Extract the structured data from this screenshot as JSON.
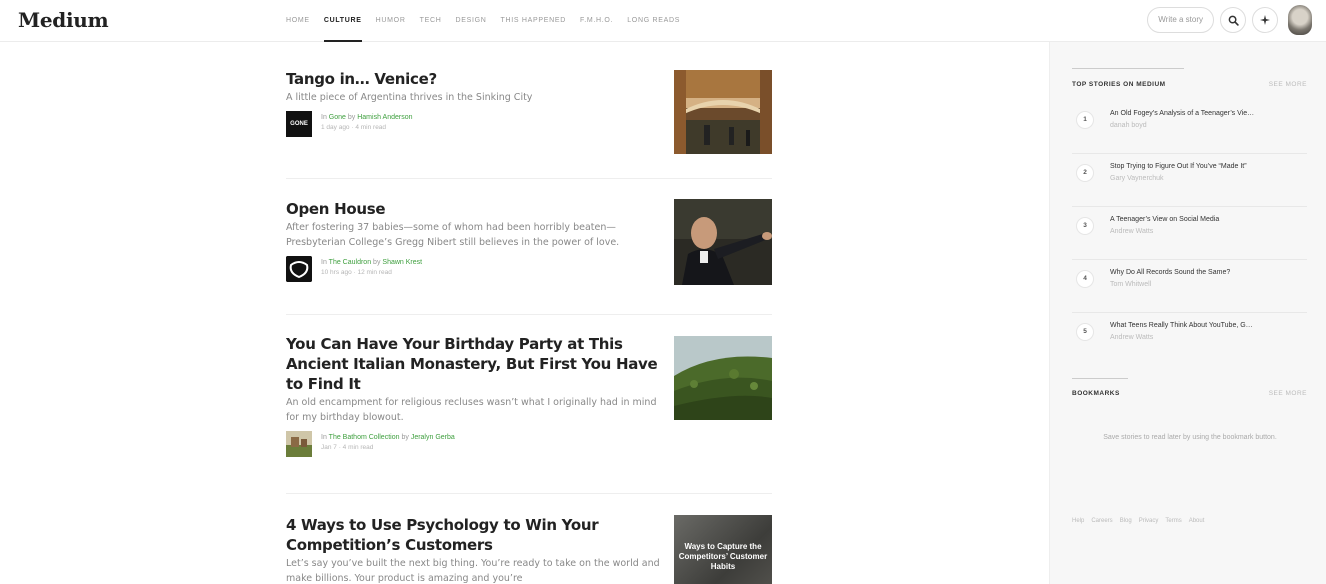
{
  "logo": "Medium",
  "nav": [
    "HOME",
    "CULTURE",
    "HUMOR",
    "TECH",
    "DESIGN",
    "THIS HAPPENED",
    "F.M.H.O.",
    "LONG READS"
  ],
  "header": {
    "write_label": "Write a story",
    "search_icon": "search-icon",
    "bell_icon": "notifications-icon"
  },
  "posts": [
    {
      "title": "Tango in… Venice?",
      "subtitle": "A little piece of Argentina thrives in the Sinking City",
      "in_label": "In",
      "publication": "Gone",
      "by_label": "by",
      "author": "Hamish Anderson",
      "meta": "1 day ago · 4 min read",
      "pub_logo_text": "GONE"
    },
    {
      "title": "Open House",
      "subtitle": "After fostering 37 babies—some of whom had been horribly beaten—Presbyterian College’s Gregg Nibert still believes in the power of love.",
      "in_label": "In",
      "publication": "The Cauldron",
      "by_label": "by",
      "author": "Shawn Krest",
      "meta": "10 hrs ago · 12 min read"
    },
    {
      "title": "You Can Have Your Birthday Party at This Ancient Italian Monastery, But First You Have to Find It",
      "subtitle": "An old encampment for religious recluses wasn’t what I originally had in mind for my birthday blowout.",
      "in_label": "In",
      "publication": "The Bathom Collection",
      "by_label": "by",
      "author": "Jeralyn Gerba",
      "meta": "Jan 7 · 4 min read"
    },
    {
      "title": "4 Ways to Use Psychology to Win Your Competition’s Customers",
      "subtitle": "Let’s say you’ve built the next big thing. You’re ready to take on the world and make billions. Your product is amazing and you’re",
      "thumb_text": "Ways to Capture the Competitors’ Customer Habits"
    }
  ],
  "sidebar": {
    "top_stories_title": "TOP STORIES ON MEDIUM",
    "see_more": "SEE MORE",
    "stories": [
      {
        "num": "1",
        "title": "An Old Fogey’s Analysis of a Teenager’s Vie…",
        "author": "danah boyd"
      },
      {
        "num": "2",
        "title": "Stop Trying to Figure Out If You’ve “Made It”",
        "author": "Gary Vaynerchuk"
      },
      {
        "num": "3",
        "title": "A Teenager’s View on Social Media",
        "author": "Andrew Watts"
      },
      {
        "num": "4",
        "title": "Why Do All Records Sound the Same?",
        "author": "Tom Whitwell"
      },
      {
        "num": "5",
        "title": "What Teens Really Think About YouTube, G…",
        "author": "Andrew Watts"
      }
    ],
    "bookmarks_title": "BOOKMARKS",
    "bookmarks_see_more": "SEE MORE",
    "bookmarks_text": "Save stories to read later by using the bookmark button.",
    "footer": [
      "Help",
      "Careers",
      "Blog",
      "Privacy",
      "Terms",
      "About"
    ]
  },
  "colors": {
    "accent_green": "#3e9f3e",
    "sidebar_bg": "#f7f7f7"
  }
}
